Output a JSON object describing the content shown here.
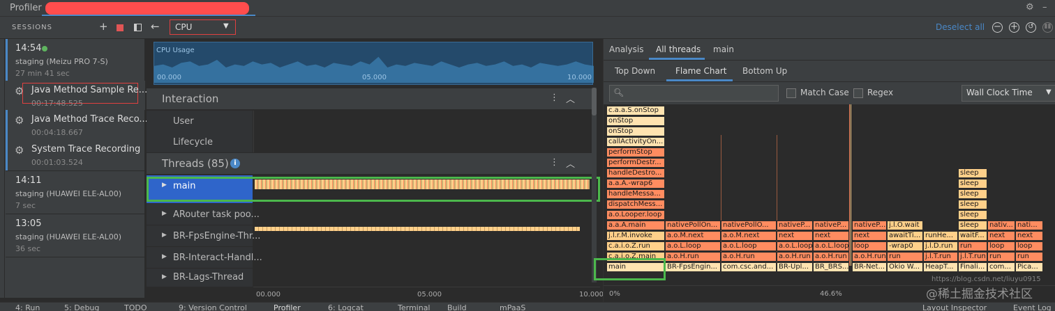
{
  "app": {
    "title": "Profiler",
    "tab_redacted": ""
  },
  "toolbar": {
    "sessions_label": "SESSIONS",
    "profiler_select": "CPU",
    "deselect_all": "Deselect all"
  },
  "sessions": [
    {
      "time": "14:54",
      "device": "staging (Meizu PRO 7-S)",
      "duration": "27 min 41 sec",
      "recordings": [
        {
          "name": "Java Method Sample Re...",
          "time": "00:17:48.525"
        },
        {
          "name": "Java Method Trace Reco...",
          "time": "00:04:18.667"
        },
        {
          "name": "System Trace Recording",
          "time": "00:01:03.524"
        }
      ]
    },
    {
      "time": "14:11",
      "device": "staging (HUAWEI ELE-AL00)",
      "duration": "7 sec"
    },
    {
      "time": "13:05",
      "device": "staging (HUAWEI ELE-AL00)",
      "duration": "36 sec"
    }
  ],
  "cpu_usage": {
    "label": "CPU Usage",
    "ticks": [
      "00.000",
      "05.000",
      "10.000"
    ],
    "values": [
      0.55,
      0.6,
      0.5,
      0.65,
      0.7,
      0.55,
      0.6,
      0.75,
      0.5,
      0.6,
      0.55,
      0.7,
      0.6,
      0.65,
      0.5,
      0.6,
      0.7,
      0.55,
      0.6,
      0.5,
      0.65,
      0.6,
      0.55,
      0.7,
      0.6,
      0.85,
      0.5,
      0.6,
      0.55,
      0.65,
      0.6,
      0.55,
      0.7,
      0.6,
      0.5,
      0.6,
      0.65,
      0.55,
      0.6,
      0.7,
      0.55,
      0.6,
      0.5,
      0.65,
      0.6,
      0.55,
      0.6,
      0.7,
      0.6,
      0.55
    ]
  },
  "interaction": {
    "title": "Interaction",
    "tracks": [
      "User",
      "Lifecycle"
    ]
  },
  "threads": {
    "title": "Threads (85)",
    "items": [
      "main",
      "ARouter task poo...",
      "BR-FpsEngine-Thr...",
      "BR-Interact-Handl...",
      "BR-Lags-Thread"
    ],
    "axis": [
      "00.000",
      "05.000",
      "10.000"
    ]
  },
  "analysis": {
    "tabs": [
      "Analysis",
      "All threads",
      "main"
    ],
    "subtabs": [
      "Top Down",
      "Flame Chart",
      "Bottom Up"
    ],
    "match_case": "Match Case",
    "regex": "Regex",
    "clock": "Wall Clock Time",
    "axis": [
      "0%",
      "46.6%"
    ]
  },
  "flame": {
    "col0": [
      "c.a.a.S.onStop",
      "onStop",
      "onStop",
      "callActivityOn...",
      "performStop",
      "performDestr...",
      "handleDestro...",
      "a.a.A.-wrap6",
      "handleMessa...",
      "dispatchMess...",
      "a.o.Looper.loop",
      "a.a.A.main",
      "j.l.r.M.invoke",
      "c.a.i.o.Z.run",
      "c.a.i.o.Z.main",
      "main"
    ],
    "row_main": [
      "nativePollOn...",
      "nativePollO...",
      "nativeP...",
      "nativeP...",
      "nativeP...",
      "j.l.O.wait",
      "sleep",
      "nativ...",
      "nati..."
    ],
    "row_next": [
      "a.o.M.next",
      "a.o.M.next",
      "next",
      "next",
      "next",
      "awaitTi...",
      "runHe...",
      "waitF...",
      "next",
      "next"
    ],
    "row_loop": [
      "a.o.L.loop",
      "a.o.L.loop",
      "a.o.L.loop",
      "a.o.L.loop",
      "loop",
      "-wrap0",
      "j.l.D.run",
      "run",
      "loop",
      "loop"
    ],
    "row_hrun": [
      "a.o.H.run",
      "a.o.H.run",
      "a.o.H.run",
      "a.o.H.run",
      "a.o.H.run",
      "run",
      "j.l.T.run",
      "j.l.T.run",
      "run",
      "run"
    ],
    "row_bottom": [
      "BR-FpsEngin...",
      "com.csc.and...",
      "BR-Upl...",
      "BR_BRS...",
      "BR-Net...",
      "Okio W...",
      "HeapT...",
      "Finali...",
      "com...",
      "Pica..."
    ],
    "sleep_col": [
      "sleep",
      "sleep",
      "sleep",
      "sleep",
      "sleep"
    ]
  },
  "bottom_tabs": [
    "4: Run",
    "5: Debug",
    "TODO",
    "9: Version Control",
    "Profiler",
    "6: Logcat",
    "Terminal",
    "Build",
    "mPaaS",
    "Layout Inspector",
    "Event Log"
  ],
  "watermark": "@稀土掘金技术社区",
  "url_watermark": "https://blog.csdn.net/liuyu0915",
  "colors": {
    "accent": "#4a88c7",
    "selection": "#2f65ca",
    "flame_orange": "#ff8c60",
    "flame_yellow": "#ffd08a",
    "highlight_green": "#4cb84c",
    "redact_red": "#ff4d4d"
  }
}
